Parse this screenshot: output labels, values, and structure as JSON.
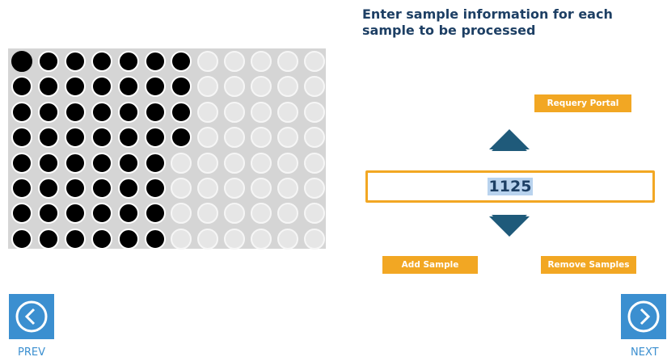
{
  "title": "Enter sample information for each sample to be processed",
  "plate": {
    "columns": 12,
    "rows": 8,
    "filled_per_row": [
      7,
      7,
      7,
      7,
      6,
      6,
      6,
      6
    ],
    "selected_well": "A1"
  },
  "buttons": {
    "requery": "Requery Portal",
    "add": "Add Sample",
    "remove": "Remove Samples"
  },
  "quantity": {
    "value": "1125"
  },
  "nav": {
    "prev": "PREV",
    "next": "NEXT"
  },
  "colors": {
    "accent": "#f2a723",
    "primary_text": "#1d3f64",
    "nav_blue": "#3b8fd0",
    "chevron": "#1f5a7a"
  },
  "icons": {
    "up": "chevron-up-icon",
    "down": "chevron-down-icon",
    "prev": "arrow-left-circle-icon",
    "next": "arrow-right-circle-icon"
  }
}
